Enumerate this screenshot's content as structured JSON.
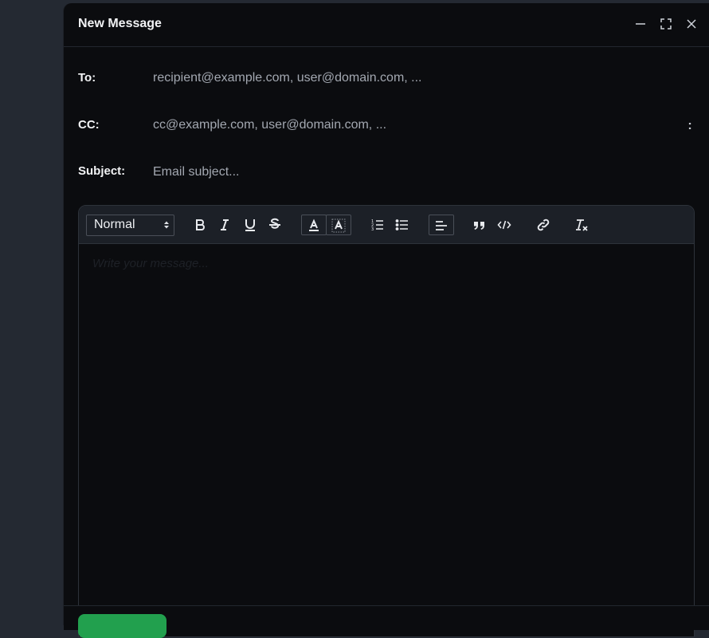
{
  "window": {
    "title": "New Message",
    "controls": [
      "minimize-icon",
      "maximize-icon",
      "close-icon"
    ]
  },
  "fields": {
    "to": {
      "label": "To:",
      "placeholder": "recipient@example.com, user@domain.com, ..."
    },
    "cc": {
      "label": "CC:",
      "placeholder": "cc@example.com, user@domain.com, ..."
    },
    "subject": {
      "label": "Subject:",
      "placeholder": "Email subject..."
    },
    "more_options": ":"
  },
  "toolbar": {
    "format_selected": "Normal",
    "buttons": [
      "bold-icon",
      "italic-icon",
      "underline-icon",
      "strikethrough-icon",
      "text-color-icon",
      "highlight-color-icon",
      "ordered-list-icon",
      "bullet-list-icon",
      "align-left-icon",
      "blockquote-icon",
      "code-icon",
      "link-icon",
      "clear-format-icon"
    ]
  },
  "editor": {
    "placeholder": "Write your message..."
  },
  "footer": {
    "send_label": ""
  },
  "colors": {
    "background": "#242932",
    "panel": "#0b0c0f",
    "toolbar": "#1c2027",
    "accent_green": "#22a04e"
  }
}
